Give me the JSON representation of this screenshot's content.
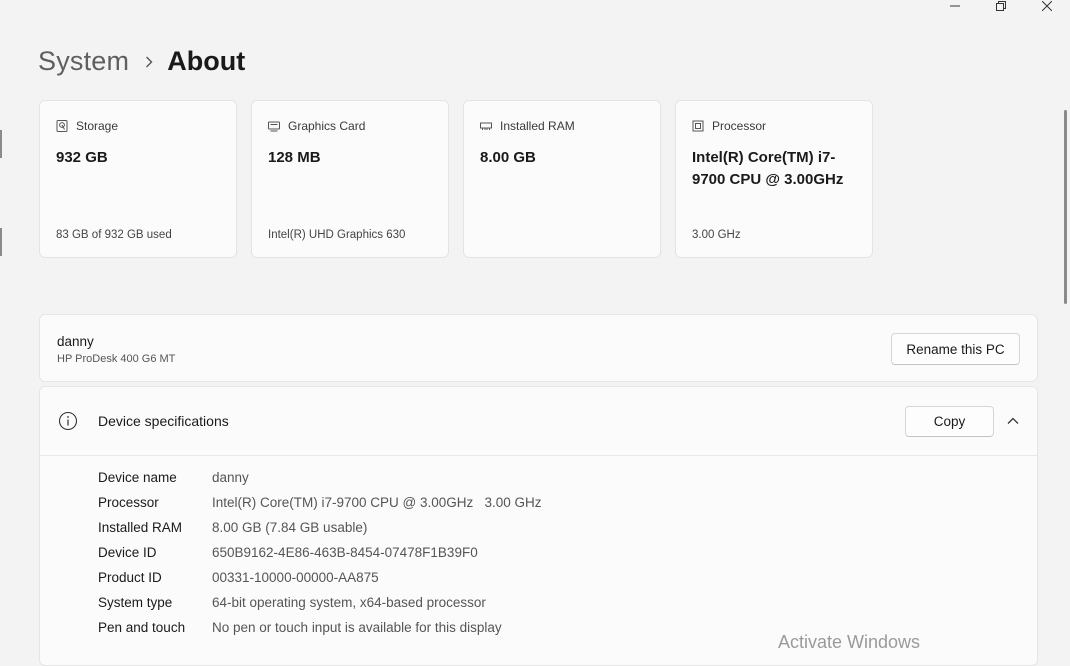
{
  "breadcrumb": {
    "parent": "System",
    "current": "About"
  },
  "cards": [
    {
      "icon": "storage-icon",
      "title": "Storage",
      "value": "932 GB",
      "sub": "83 GB of 932 GB used"
    },
    {
      "icon": "graphics-card-icon",
      "title": "Graphics Card",
      "value": "128 MB",
      "sub": "Intel(R) UHD Graphics 630"
    },
    {
      "icon": "ram-icon",
      "title": "Installed RAM",
      "value": "8.00 GB",
      "sub": ""
    },
    {
      "icon": "processor-icon",
      "title": "Processor",
      "value": "Intel(R) Core(TM) i7-9700 CPU @ 3.00GHz",
      "sub": "3.00 GHz"
    }
  ],
  "pc": {
    "name": "danny",
    "model": "HP ProDesk 400 G6 MT",
    "rename_label": "Rename this PC"
  },
  "specs": {
    "title": "Device specifications",
    "copy_label": "Copy",
    "rows": [
      {
        "label": "Device name",
        "value": "danny"
      },
      {
        "label": "Processor",
        "value": "Intel(R) Core(TM) i7-9700 CPU @ 3.00GHz   3.00 GHz"
      },
      {
        "label": "Installed RAM",
        "value": "8.00 GB (7.84 GB usable)"
      },
      {
        "label": "Device ID",
        "value": "650B9162-4E86-463B-8454-07478F1B39F0"
      },
      {
        "label": "Product ID",
        "value": "00331-10000-00000-AA875"
      },
      {
        "label": "System type",
        "value": "64-bit operating system, x64-based processor"
      },
      {
        "label": "Pen and touch",
        "value": "No pen or touch input is available for this display"
      }
    ]
  },
  "watermark": "Activate Windows",
  "colors": {
    "background": "#f3f3f3",
    "card": "#fbfbfb",
    "border": "#e3e3e3"
  }
}
